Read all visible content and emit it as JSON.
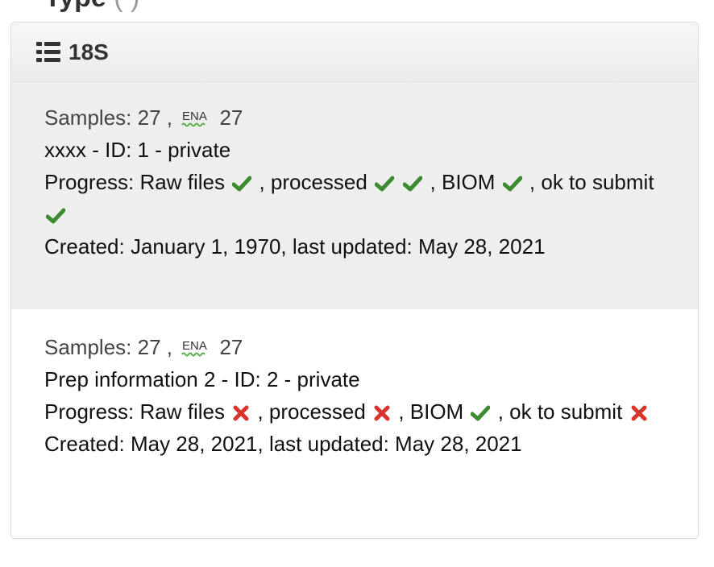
{
  "section": {
    "title": "18S",
    "list_icon": "list-icon"
  },
  "colors": {
    "check": "#3d8b2f",
    "cross": "#d9342b",
    "active_row_bg": "#eeeeee",
    "header_bg": "#eeeeee"
  },
  "preps": [
    {
      "samples_label": "Samples: 27 ,",
      "ena_logo": "ENA",
      "ena_count": "27",
      "name_line": "xxxx - ID: 1 - private",
      "progress": {
        "prefix": "Progress: Raw files",
        "processed_label": ", processed",
        "biom_label": ", BIOM",
        "ok_label": ", ok to submit",
        "raw_files": "check",
        "processed": [
          "check",
          "check"
        ],
        "biom": "check",
        "ok_to_submit": "check"
      },
      "dates": "Created: January 1, 1970, last updated: May 28, 2021"
    },
    {
      "samples_label": "Samples: 27 ,",
      "ena_logo": "ENA",
      "ena_count": "27",
      "name_line": "Prep information 2 - ID: 2 - private",
      "progress": {
        "prefix": "Progress: Raw files",
        "processed_label": ", processed",
        "biom_label": ", BIOM",
        "ok_label": ", ok to submit",
        "raw_files": "cross",
        "processed": [
          "cross"
        ],
        "biom": "check",
        "ok_to_submit": "cross"
      },
      "dates": "Created: May 28, 2021, last updated: May 28, 2021"
    }
  ]
}
